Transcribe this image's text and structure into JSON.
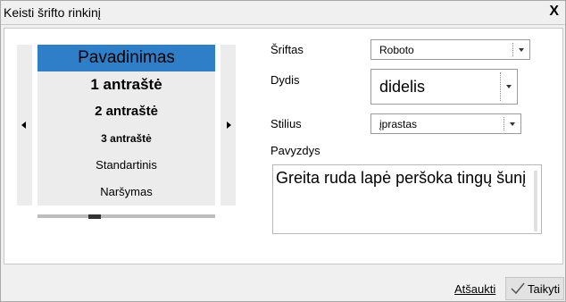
{
  "dialog": {
    "title": "Keisti šrifto rinkinį",
    "close_label": "X"
  },
  "styles_list": {
    "items": [
      "Pavadinimas",
      "1 antraštė",
      "2 antraštė",
      "3 antraštė",
      "Standartinis",
      "Naršymas"
    ],
    "selected_index": 0
  },
  "font": {
    "label": "Šriftas",
    "value": "Roboto"
  },
  "size": {
    "label": "Dydis",
    "value": "didelis"
  },
  "style": {
    "label": "Stilius",
    "value": "įprastas"
  },
  "preview": {
    "label": "Pavyzdys",
    "text": "Greita ruda lapė peršoka tingų šunį"
  },
  "footer": {
    "cancel_label": "Atšaukti",
    "apply_label": "Taikyti"
  },
  "colors": {
    "selected_item": "#2f7fc8",
    "panel": "#ececec"
  }
}
